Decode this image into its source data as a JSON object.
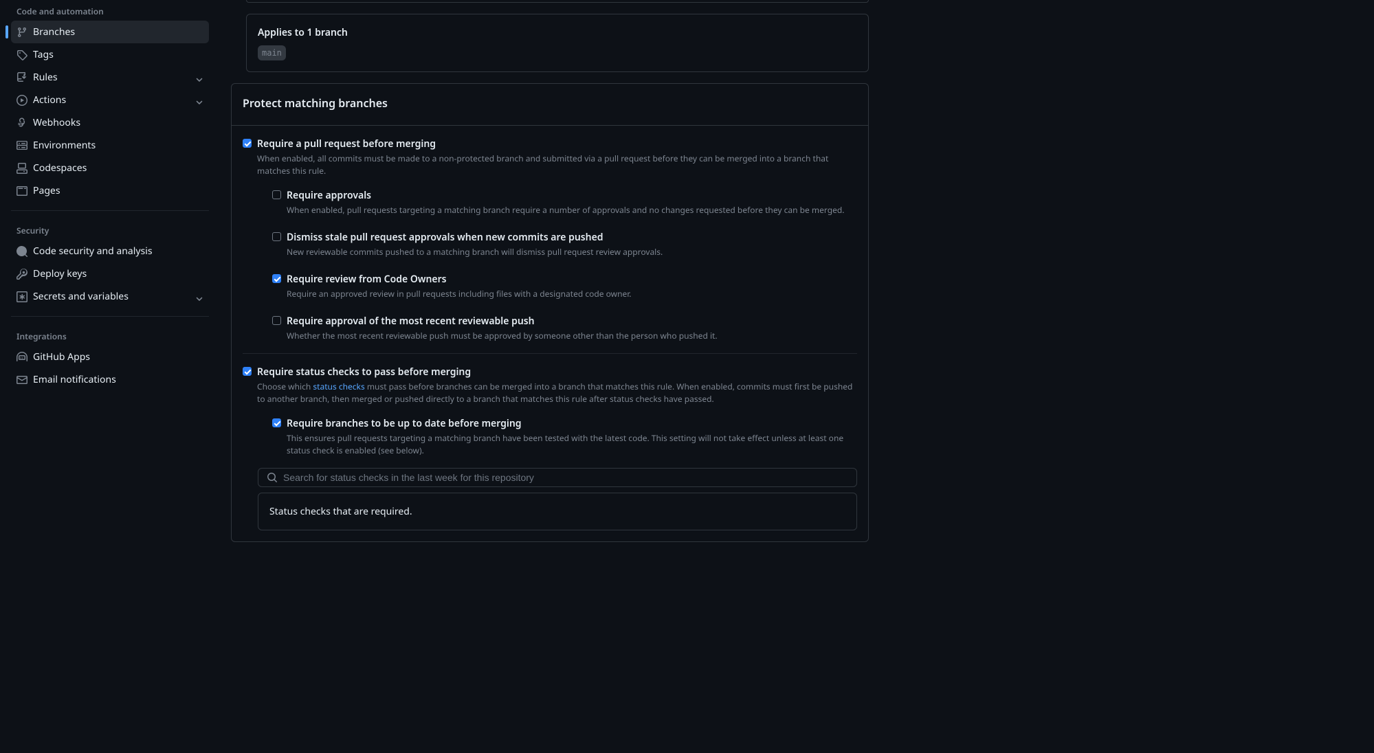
{
  "sidebar": {
    "sections": {
      "code_automation": {
        "heading": "Code and automation",
        "items": {
          "branches": "Branches",
          "tags": "Tags",
          "rules": "Rules",
          "actions": "Actions",
          "webhooks": "Webhooks",
          "environments": "Environments",
          "codespaces": "Codespaces",
          "pages": "Pages"
        }
      },
      "security": {
        "heading": "Security",
        "items": {
          "code_security": "Code security and analysis",
          "deploy_keys": "Deploy keys",
          "secrets": "Secrets and variables"
        }
      },
      "integrations": {
        "heading": "Integrations",
        "items": {
          "github_apps": "GitHub Apps",
          "email_notifications": "Email notifications"
        }
      }
    }
  },
  "applies": {
    "heading": "Applies to 1 branch",
    "branch": "main"
  },
  "protect_heading": "Protect matching branches",
  "rules": {
    "require_pr": {
      "title": "Require a pull request before merging",
      "desc": "When enabled, all commits must be made to a non-protected branch and submitted via a pull request before they can be merged into a branch that matches this rule."
    },
    "require_approvals": {
      "title": "Require approvals",
      "desc": "When enabled, pull requests targeting a matching branch require a number of approvals and no changes requested before they can be merged."
    },
    "dismiss_stale": {
      "title": "Dismiss stale pull request approvals when new commits are pushed",
      "desc": "New reviewable commits pushed to a matching branch will dismiss pull request review approvals."
    },
    "codeowners": {
      "title": "Require review from Code Owners",
      "desc": "Require an approved review in pull requests including files with a designated code owner."
    },
    "recent_push": {
      "title": "Require approval of the most recent reviewable push",
      "desc": "Whether the most recent reviewable push must be approved by someone other than the person who pushed it."
    },
    "status_checks": {
      "title": "Require status checks to pass before merging",
      "desc_prefix": "Choose which ",
      "desc_link": "status checks",
      "desc_suffix": " must pass before branches can be merged into a branch that matches this rule. When enabled, commits must first be pushed to another branch, then merged or pushed directly to a branch that matches this rule after status checks have passed."
    },
    "up_to_date": {
      "title": "Require branches to be up to date before merging",
      "desc": "This ensures pull requests targeting a matching branch have been tested with the latest code. This setting will not take effect unless at least one status check is enabled (see below)."
    }
  },
  "search": {
    "placeholder": "Search for status checks in the last week for this repository"
  },
  "status_required": {
    "text": "Status checks that are required."
  }
}
